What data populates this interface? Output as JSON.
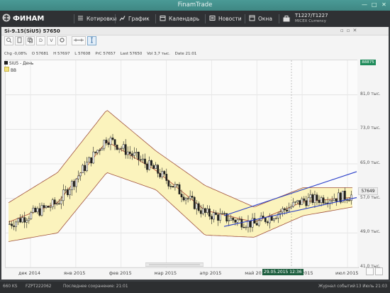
{
  "window": {
    "title": "FinamTrade",
    "minimize": "—",
    "maximize": "□",
    "close": "✕"
  },
  "toolbar": {
    "brand": "ФИНАМ",
    "items": [
      {
        "label": "Котировки",
        "icon": "quotes-icon"
      },
      {
        "label": "График",
        "icon": "chart-icon"
      },
      {
        "label": "Календарь",
        "icon": "calendar-icon"
      },
      {
        "label": "Новости",
        "icon": "news-icon"
      },
      {
        "label": "Окна",
        "icon": "windows-icon"
      }
    ],
    "instrument": {
      "line1": "T1227/T1227",
      "line2": "MICEX Currency"
    }
  },
  "chart_panel": {
    "title": "Si-9.15(SiU5) 57650",
    "tools": [
      "zoom-icon",
      "document-icon",
      "copy-icon",
      "D",
      "V",
      "settings-icon",
      "drawing-icon",
      "cursor-icon"
    ],
    "info": {
      "chg": "Chg -0,08%",
      "o": "O 57681",
      "h": "H 57697",
      "l": "L 57608",
      "prc": "PrC 57657",
      "last": "Last 57650",
      "vol": "Vol 3,7 тыс.",
      "date": "Date 21:01"
    },
    "series": [
      {
        "name": "SiU5 - День",
        "color": "#1e1e1e"
      },
      {
        "name": "BB",
        "color": "#f2e27a"
      }
    ]
  },
  "axis": {
    "y_ticks": [
      "81,0 тыс.",
      "73,0 тыс.",
      "65,0 тыс.",
      "57,0 тыс.",
      "49,0 тыс.",
      "41,0 тыс."
    ],
    "x_ticks": [
      "дек 2014",
      "янв 2015",
      "фев 2015",
      "мар 2015",
      "апр 2015",
      "май 2015",
      "июн 2015",
      "июл 2015"
    ],
    "last_price": "57649",
    "top_price": "88875",
    "cursor_date": "29.05.2015 12:36"
  },
  "status": {
    "left": "660 KS",
    "account": "FZPT222062",
    "saved": "Последнее сохранение: 21:01",
    "journal": "Журнал событий",
    "clock": "13 Июль 21:03"
  },
  "chart_data": {
    "type": "candlestick",
    "title": "Si-9.15(SiU5) 57650",
    "series_names": [
      "SiU5 - День",
      "BB"
    ],
    "ylim": [
      41000,
      89000
    ],
    "x": [
      "дек 2014",
      "янв 2015",
      "фев 2015",
      "мар 2015",
      "апр 2015",
      "май 2015",
      "июн 2015",
      "июл 2015"
    ],
    "close": [
      51000,
      56000,
      71000,
      63500,
      53500,
      51000,
      56500,
      57650
    ],
    "bb_upper": [
      56000,
      63000,
      77500,
      68000,
      60000,
      55000,
      59500,
      59500
    ],
    "bb_lower": [
      47000,
      49000,
      63000,
      59000,
      48500,
      48000,
      53000,
      55000
    ],
    "grid": true,
    "legend": "top-left"
  }
}
